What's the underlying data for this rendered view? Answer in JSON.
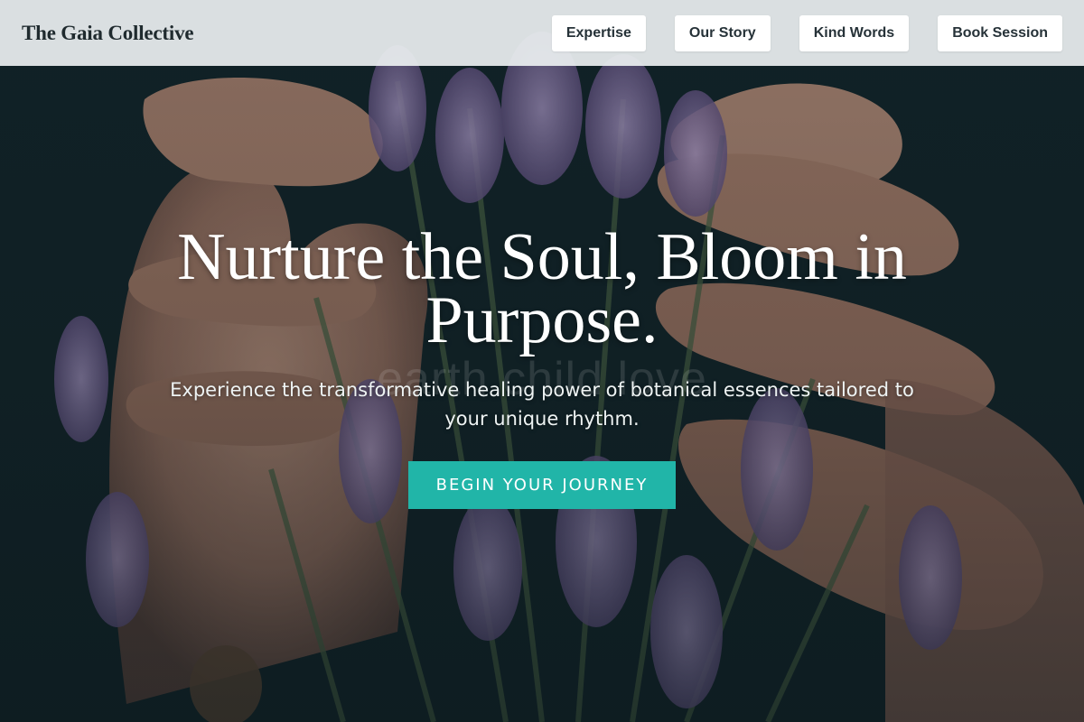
{
  "brand": {
    "name": "The Gaia Collective"
  },
  "nav": {
    "items": [
      {
        "label": "Expertise"
      },
      {
        "label": "Our Story"
      },
      {
        "label": "Kind Words"
      },
      {
        "label": "Book Session"
      }
    ]
  },
  "hero": {
    "headline": "Nurture the Soul, Bloom in Purpose.",
    "ghost_text": "earth child love",
    "subtitle": "Experience the transformative healing power of botanical essences tailored to your unique rhythm.",
    "cta_label": "BEGIN YOUR JOURNEY"
  },
  "colors": {
    "accent": "#21b5a8",
    "header_bg": "#ecf0f1",
    "text_dark": "#1f2a2e"
  },
  "icons": {
    "background": "hands-holding-lavender-photo"
  }
}
